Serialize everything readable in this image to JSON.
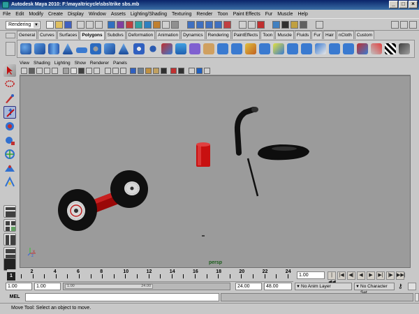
{
  "window": {
    "title": "Autodesk Maya 2010: F:\\maya\\tricycle\\sbs\\trike sbs.mb",
    "minimize": "_",
    "maximize": "□",
    "close": "×"
  },
  "menubar": [
    "File",
    "Edit",
    "Modify",
    "Create",
    "Display",
    "Window",
    "Assets",
    "Lighting/Shading",
    "Texturing",
    "Render",
    "Toon",
    "Paint Effects",
    "Fur",
    "Muscle",
    "Help"
  ],
  "statusline": {
    "menuset": "Rendering"
  },
  "shelf": {
    "tabs": [
      "General",
      "Curves",
      "Surfaces",
      "Polygons",
      "Subdivs",
      "Deformation",
      "Animation",
      "Dynamics",
      "Rendering",
      "PaintEffects",
      "Toon",
      "Muscle",
      "Fluids",
      "Fur",
      "Hair",
      "nCloth",
      "Custom"
    ],
    "active_tab": "Polygons"
  },
  "panel": {
    "menus": [
      "View",
      "Shading",
      "Lighting",
      "Show",
      "Renderer",
      "Panels"
    ],
    "camera": "persp"
  },
  "timeslider": {
    "current_frame": "1",
    "tick_labels": [
      "2",
      "4",
      "6",
      "8",
      "10",
      "12",
      "14",
      "16",
      "18",
      "20",
      "22",
      "24"
    ],
    "current_time_field": "1.00"
  },
  "playback": {
    "buttons": [
      "|◀◀",
      "|◀",
      "◀|",
      "◀",
      "▶",
      "▶|",
      "|▶",
      "▶▶|"
    ]
  },
  "range": {
    "start": "1.00",
    "anim_start": "1.00",
    "end": "24.00",
    "anim_end": "48.00",
    "slider_start": "1.00",
    "slider_end": "24.00",
    "anim_layer": "No Anim Layer",
    "character_set": "No Character Set"
  },
  "commandline": {
    "language": "MEL"
  },
  "helpline": {
    "text": "Move Tool: Select an object to move."
  },
  "colors": {
    "viewport_bg": "#9b9b9b",
    "frame_red": "#c01010",
    "tire": "#101010",
    "selected_tool": "#a8b8d8"
  },
  "icons": {
    "toolbox": [
      "select-icon",
      "lasso-icon",
      "paint-select-icon",
      "move-icon",
      "rotate-icon",
      "scale-icon",
      "manipulator-icon",
      "soft-mod-icon",
      "show-manipulator-icon",
      "layout-single-icon",
      "layout-four-icon",
      "layout-side-icon",
      "layout-outliner-icon"
    ]
  }
}
